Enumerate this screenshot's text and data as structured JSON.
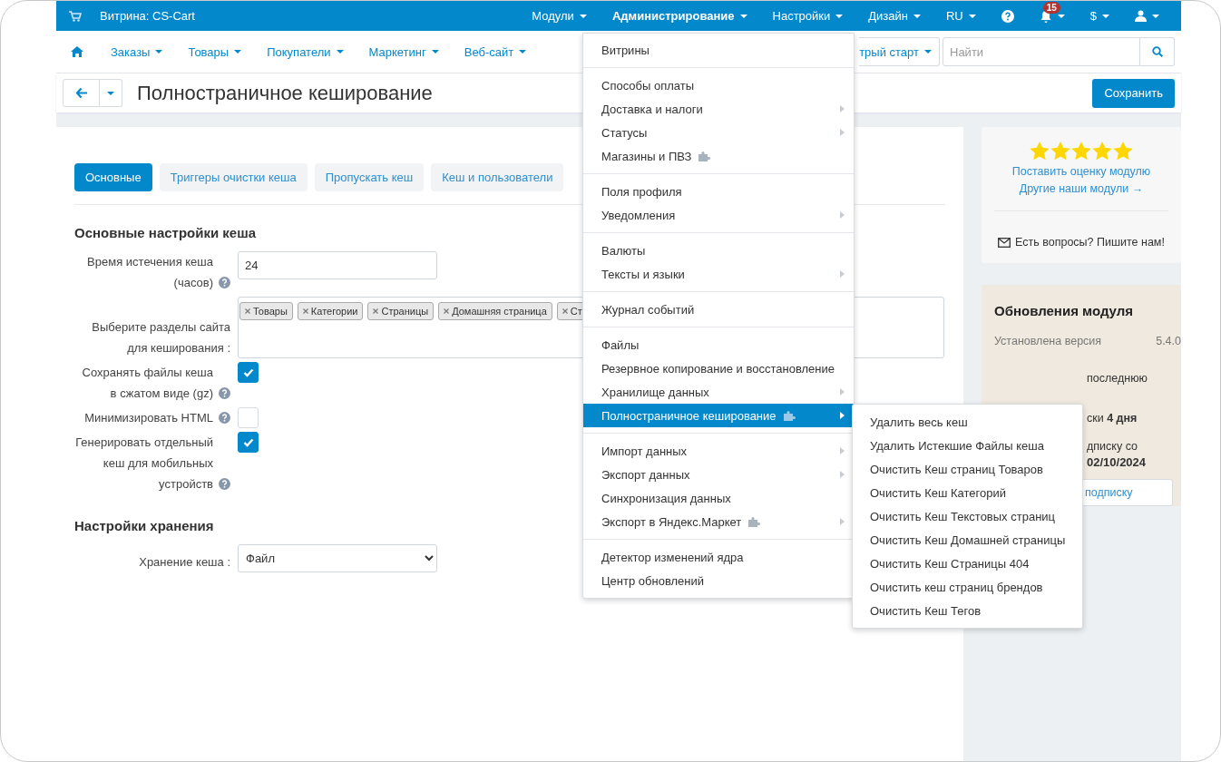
{
  "topbar": {
    "store": "Витрина: CS-Cart",
    "menus": [
      {
        "label": "Модули",
        "selected": false
      },
      {
        "label": "Администрирование",
        "selected": true
      },
      {
        "label": "Настройки",
        "selected": false
      },
      {
        "label": "Дизайн",
        "selected": false
      },
      {
        "label": "RU",
        "selected": false
      }
    ],
    "notifications": "15",
    "currency": "$"
  },
  "navbar": {
    "items": [
      "Заказы",
      "Товары",
      "Покупатели",
      "Маркетинг",
      "Веб-сайт"
    ],
    "quick_start": "трый старт",
    "search": {
      "placeholder": "Найти"
    }
  },
  "titlebar": {
    "title": "Полностраничное кеширование",
    "save": "Сохранить"
  },
  "tabs": [
    {
      "label": "Основные",
      "selected": true
    },
    {
      "label": "Триггеры очистки кеша",
      "selected": false
    },
    {
      "label": "Пропускать кеш",
      "selected": false
    },
    {
      "label": "Кеш и пользователи",
      "selected": false
    }
  ],
  "sections": [
    {
      "title": "Основные настройки кеша",
      "fields": [
        {
          "kind": "input",
          "label": "Время истечения кеша (часов)",
          "help": true,
          "value": "24"
        },
        {
          "kind": "tags",
          "label": "Выберите разделы сайта для кеширования :",
          "help": false,
          "tags": [
            "Товары",
            "Категории",
            "Страницы",
            "Домашняя страница",
            "Ст"
          ]
        },
        {
          "kind": "checkbox",
          "label": "Сохранять файлы кеша в сжатом виде (gz)",
          "help": true,
          "checked": true
        },
        {
          "kind": "checkbox",
          "label": "Минимизировать HTML",
          "help": true,
          "checked": false
        },
        {
          "kind": "checkbox",
          "label": "Генерировать отдельный кеш для мобильных устройств",
          "help": true,
          "checked": true
        }
      ]
    },
    {
      "title": "Настройки хранения",
      "fields": [
        {
          "kind": "select",
          "label": "Хранение кеша :",
          "help": false,
          "value": "Файл"
        }
      ]
    }
  ],
  "sidebar": {
    "stars": 5,
    "rate_link": "Поставить оценку модулю",
    "modules_link": "Другие наши модули →",
    "contact": "Есть вопросы? Пишите нам!",
    "updates": {
      "title": "Обновления модуля",
      "version_label": "Установлена версия",
      "version": "5.4.0",
      "lines": [
        "последнюю",
        "ски **4 дня**",
        "дписку со"
      ],
      "date": "02/10/2024",
      "button": "подписку"
    }
  },
  "admin_menu": {
    "groups": [
      [
        {
          "label": "Витрины",
          "arrow": false,
          "addon": false,
          "selected": false
        }
      ],
      [
        {
          "label": "Способы оплаты",
          "arrow": false,
          "addon": false,
          "selected": false
        },
        {
          "label": "Доставка и налоги",
          "arrow": true,
          "addon": false,
          "selected": false
        },
        {
          "label": "Статусы",
          "arrow": true,
          "addon": false,
          "selected": false
        },
        {
          "label": "Магазины и ПВЗ",
          "arrow": false,
          "addon": true,
          "selected": false
        }
      ],
      [
        {
          "label": "Поля профиля",
          "arrow": false,
          "addon": false,
          "selected": false
        },
        {
          "label": "Уведомления",
          "arrow": true,
          "addon": false,
          "selected": false
        }
      ],
      [
        {
          "label": "Валюты",
          "arrow": false,
          "addon": false,
          "selected": false
        },
        {
          "label": "Тексты и языки",
          "arrow": true,
          "addon": false,
          "selected": false
        }
      ],
      [
        {
          "label": "Журнал событий",
          "arrow": false,
          "addon": false,
          "selected": false
        }
      ],
      [
        {
          "label": "Файлы",
          "arrow": false,
          "addon": false,
          "selected": false
        },
        {
          "label": "Резервное копирование и восстановление",
          "arrow": false,
          "addon": false,
          "selected": false
        },
        {
          "label": "Хранилище данных",
          "arrow": true,
          "addon": false,
          "selected": false
        },
        {
          "label": "Полностраничное кеширование",
          "arrow": true,
          "addon": true,
          "selected": true
        }
      ],
      [
        {
          "label": "Импорт данных",
          "arrow": true,
          "addon": false,
          "selected": false
        },
        {
          "label": "Экспорт данных",
          "arrow": true,
          "addon": false,
          "selected": false
        },
        {
          "label": "Синхронизация данных",
          "arrow": false,
          "addon": false,
          "selected": false
        },
        {
          "label": "Экспорт в Яндекс.Маркет",
          "arrow": true,
          "addon": true,
          "selected": false
        }
      ],
      [
        {
          "label": "Детектор изменений ядра",
          "arrow": false,
          "addon": false,
          "selected": false
        },
        {
          "label": "Центр обновлений",
          "arrow": false,
          "addon": false,
          "selected": false
        }
      ]
    ]
  },
  "submenu": [
    "Удалить весь кеш",
    "Удалить Истекшие Файлы кеша",
    "Очистить Кеш страниц Товаров",
    "Очистить Кеш Категорий",
    "Очистить Кеш Текстовых страниц",
    "Очистить Кеш Домашней страницы",
    "Очистить Кеш Страницы 404",
    "Очистить кеш страниц брендов",
    "Очистить Кеш Тегов"
  ]
}
